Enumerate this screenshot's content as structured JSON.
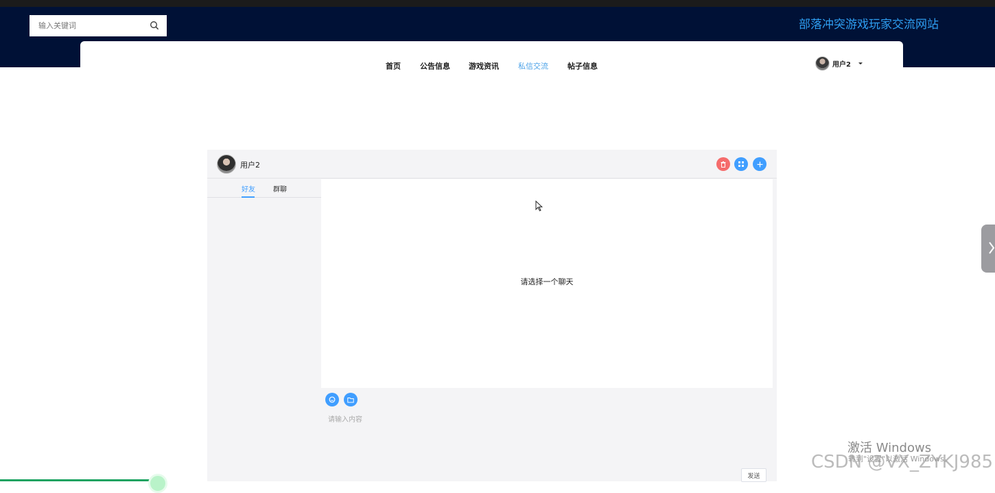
{
  "search": {
    "placeholder": "输入关键词"
  },
  "site": {
    "title": "部落冲突游戏玩家交流网站"
  },
  "nav": {
    "items": [
      {
        "label": "首页"
      },
      {
        "label": "公告信息"
      },
      {
        "label": "游戏资讯"
      },
      {
        "label": "私信交流"
      },
      {
        "label": "帖子信息"
      }
    ],
    "active": "私信交流"
  },
  "user": {
    "name": "用户2"
  },
  "chat": {
    "current_user": "用户2",
    "tabs": [
      {
        "label": "好友"
      },
      {
        "label": "群聊"
      }
    ],
    "active_tab": "好友",
    "empty_text": "请选择一个聊天",
    "input_placeholder": "请输入内容",
    "send_label": "发送"
  },
  "overlay": {
    "windows_activate": "激活 Windows",
    "windows_hint": "转到\"设置\"以激活 Windows。",
    "csdn_mark": "CSDN @VX_ZYKJ985"
  },
  "colors": {
    "header_bg": "#001136",
    "title": "#2e9df0",
    "accent": "#409eff",
    "danger": "#f56c6c"
  },
  "icons": [
    "search-icon",
    "avatar",
    "delete-icon",
    "grid-icon",
    "plus-icon",
    "emoji-icon",
    "folder-icon",
    "chevron-right-icon",
    "cursor-icon"
  ]
}
